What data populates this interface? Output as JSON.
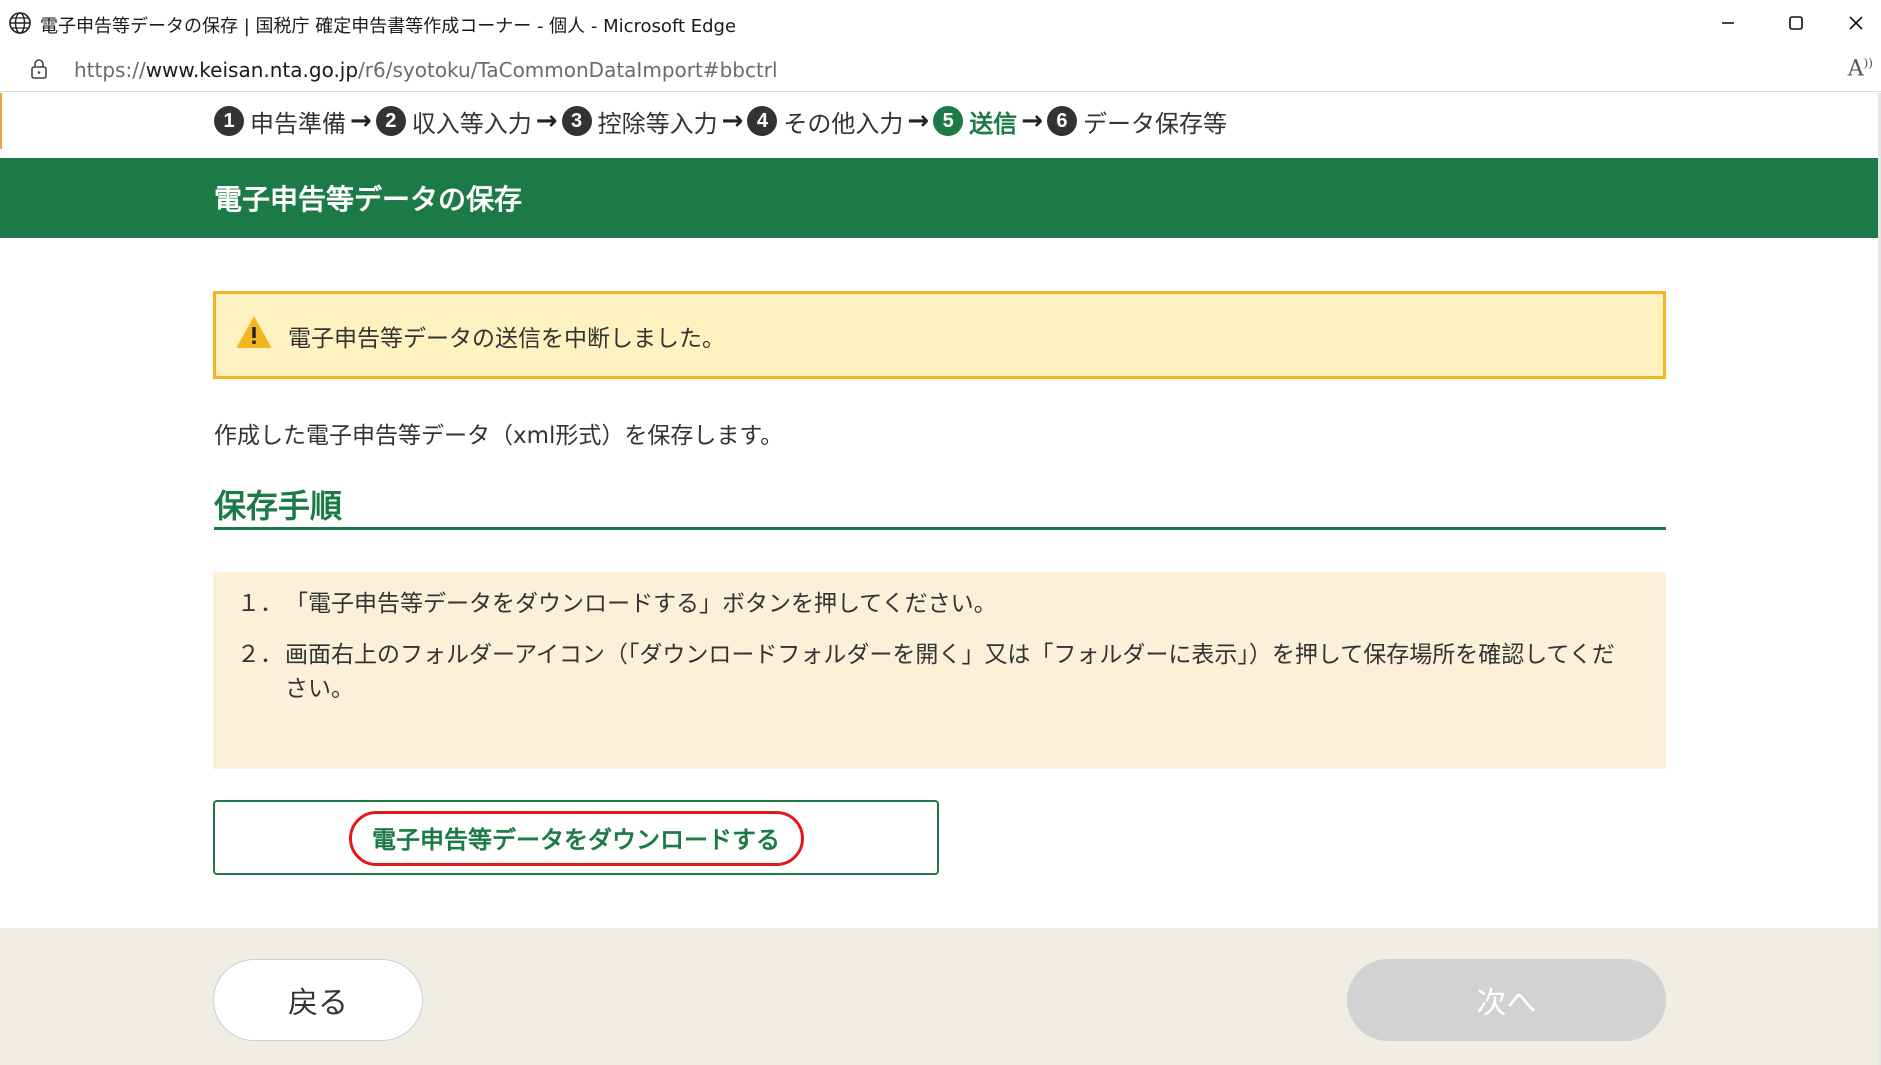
{
  "window": {
    "title": "電子申告等データの保存 | 国税庁 確定申告書等作成コーナー - 個人 - Microsoft Edge",
    "minimize_icon": "minimize-icon",
    "maximize_icon": "maximize-icon",
    "close_icon": "close-icon"
  },
  "address_bar": {
    "url_prefix": "https://",
    "url_host": "www.keisan.nta.go.jp",
    "url_path": "/r6/syotoku/TaCommonDataImport#bbctrl",
    "read_aloud": "A"
  },
  "steps": [
    {
      "num": "1",
      "label": "申告準備",
      "active": false
    },
    {
      "num": "2",
      "label": "収入等入力",
      "active": false
    },
    {
      "num": "3",
      "label": "控除等入力",
      "active": false
    },
    {
      "num": "4",
      "label": "その他入力",
      "active": false
    },
    {
      "num": "5",
      "label": "送信",
      "active": true
    },
    {
      "num": "6",
      "label": "データ保存等",
      "active": false
    }
  ],
  "banner": {
    "title": "電子申告等データの保存"
  },
  "alert": {
    "message": "電子申告等データの送信を中断しました。",
    "icon": "warning-icon"
  },
  "intro": "作成した電子申告等データ（xml形式）を保存します。",
  "section": {
    "title": "保存手順"
  },
  "instructions": [
    {
      "num": "１．",
      "text": "「電子申告等データをダウンロードする」ボタンを押してください。"
    },
    {
      "num": "２．",
      "text": "画面右上のフォルダーアイコン（「ダウンロードフォルダーを開く」又は「フォルダーに表示」）を押して保存場所を確認してください。"
    }
  ],
  "download_button": {
    "label": "電子申告等データをダウンロードする"
  },
  "footer": {
    "back_label": "戻る",
    "next_label": "次へ"
  },
  "colors": {
    "brand_green": "#1b7a45",
    "alert_bg": "#fef3c0",
    "alert_border": "#f4b522",
    "highlight_red": "#e2191c"
  }
}
